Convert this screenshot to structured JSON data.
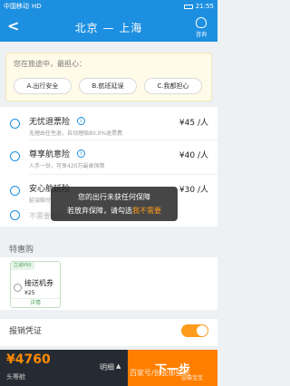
{
  "status_bar": {
    "carrier": "中国移动",
    "signal": "HD",
    "time": "21:55"
  },
  "nav": {
    "title": "北京 — 上海",
    "back_label": "<",
    "consult_label": "咨询"
  },
  "worry": {
    "question": "您在旅途中，最担心：",
    "options": [
      "A.出行安全",
      "B.航班延误",
      "C.我都担心"
    ]
  },
  "insurances": [
    {
      "name": "无忧退票险",
      "desc": "无理由任性退，自动理赔80.0%退票费",
      "price": "¥45 /人"
    },
    {
      "name": "尊享航意险",
      "desc": "人手一份，可享420万最高保障",
      "price": "¥40 /人"
    },
    {
      "name": "安心航延险",
      "desc": "延误赔付",
      "price": "¥30 /人"
    },
    {
      "name": "",
      "desc": "不需要额外保障",
      "price": ""
    }
  ],
  "toast": {
    "line1": "您的出行未获任何保障",
    "line2_prefix": "若放弃保障，请勾选",
    "line2_highlight": "我不需要"
  },
  "deals": {
    "section_title": "特惠购",
    "item": {
      "badge": "立减¥90",
      "name": "接送机券",
      "price": "¥25",
      "detail_label": "详情"
    }
  },
  "receipt": {
    "label": "报销凭证"
  },
  "bottom": {
    "total_price": "¥4760",
    "cabin": "头等舱",
    "detail_label": "明细",
    "detail_arrow": "▲",
    "next_label": "下一步"
  },
  "watermark": {
    "text": "百家号/创业那些坑",
    "sub": "@猫宝宝"
  },
  "colors": {
    "primary": "#1d8fe0",
    "accent": "#ff7e00",
    "price": "#ff8a00"
  }
}
